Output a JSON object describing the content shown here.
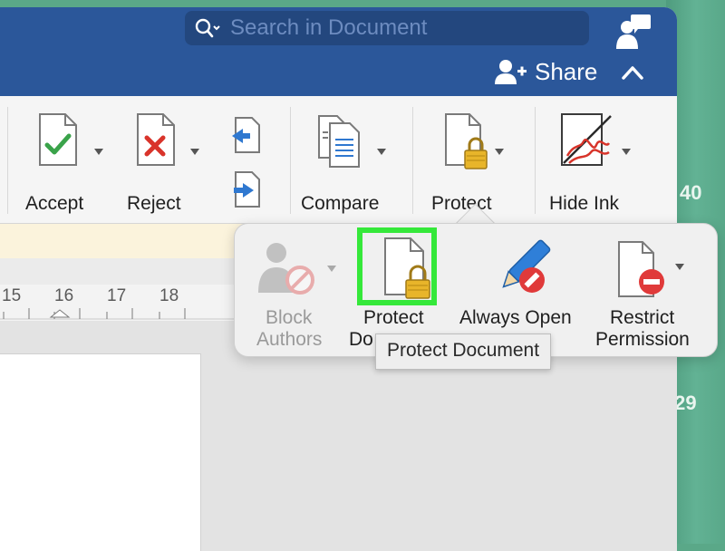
{
  "search": {
    "placeholder": "Search in Document"
  },
  "header": {
    "share_label": "Share"
  },
  "ribbon": {
    "accept_label": "Accept",
    "reject_label": "Reject",
    "compare_label": "Compare",
    "protect_label": "Protect",
    "hide_ink_label": "Hide Ink"
  },
  "ruler": {
    "numbers": [
      "15",
      "16",
      "17",
      "18"
    ]
  },
  "popover": {
    "block_authors_line1": "Block",
    "block_authors_line2": "Authors",
    "protect_document_line1": "Protect",
    "protect_document_line2": "Do",
    "always_open_line1": "Always Open",
    "restrict_permission_line1": "Restrict",
    "restrict_permission_line2": "Permission"
  },
  "tooltip": {
    "text": "Protect Document"
  },
  "background": {
    "numbers": [
      "40",
      ".29"
    ]
  },
  "colors": {
    "title_bar": "#2b579a",
    "search_bg": "#23477e",
    "highlight": "#35e83a",
    "accept_check": "#3aa34a",
    "reject_x": "#d9342b",
    "lock": "#e8b52a"
  }
}
